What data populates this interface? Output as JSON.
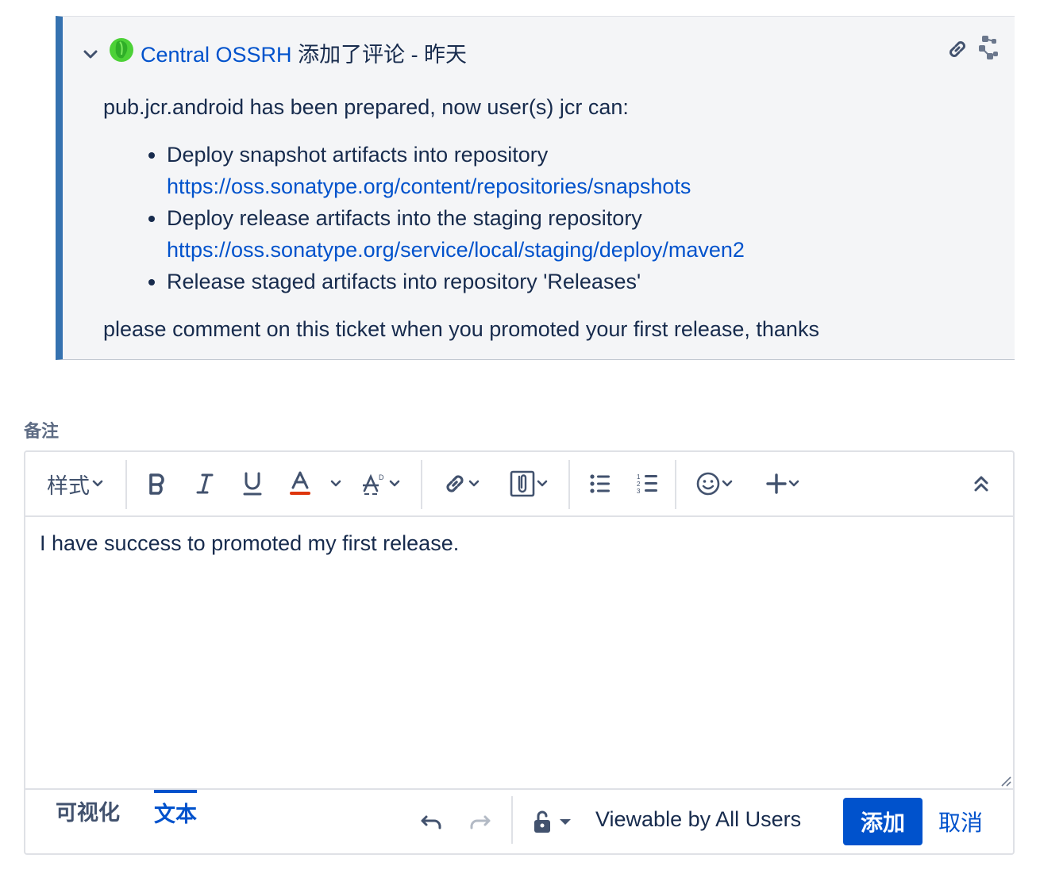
{
  "comment": {
    "author": "Central OSSRH",
    "action": " 添加了评论 - 昨天",
    "intro": "pub.jcr.android has been prepared, now user(s) jcr can:",
    "items": [
      {
        "text": "Deploy snapshot artifacts into repository",
        "url": "https://oss.sonatype.org/content/repositories/snapshots"
      },
      {
        "text": "Deploy release artifacts into the staging repository",
        "url": "https://oss.sonatype.org/service/local/staging/deploy/maven2"
      },
      {
        "text": "Release staged artifacts into repository 'Releases'"
      }
    ],
    "outro": "please comment on this ticket when you promoted your first release, thanks"
  },
  "remark_label": "备注",
  "toolbar": {
    "style_label": "样式",
    "icons": [
      "bold-icon",
      "italic-icon",
      "underline-icon",
      "text-color-icon",
      "text-effects-icon",
      "link-icon",
      "attachment-icon",
      "bullet-list-icon",
      "numbered-list-icon",
      "emoji-icon",
      "insert-more-icon",
      "collapse-toolbar-icon"
    ],
    "text_color_accent": "#de350b"
  },
  "editor": {
    "content": "I have success to promoted my first release."
  },
  "footer": {
    "tabs": [
      "可视化",
      "文本"
    ],
    "active_tab": "文本",
    "viewable": "Viewable by All Users",
    "add_label": "添加",
    "cancel_label": "取消"
  },
  "colors": {
    "accent": "#0052cc",
    "comment_border": "#3572b0",
    "comment_bg": "#f4f5f7"
  }
}
